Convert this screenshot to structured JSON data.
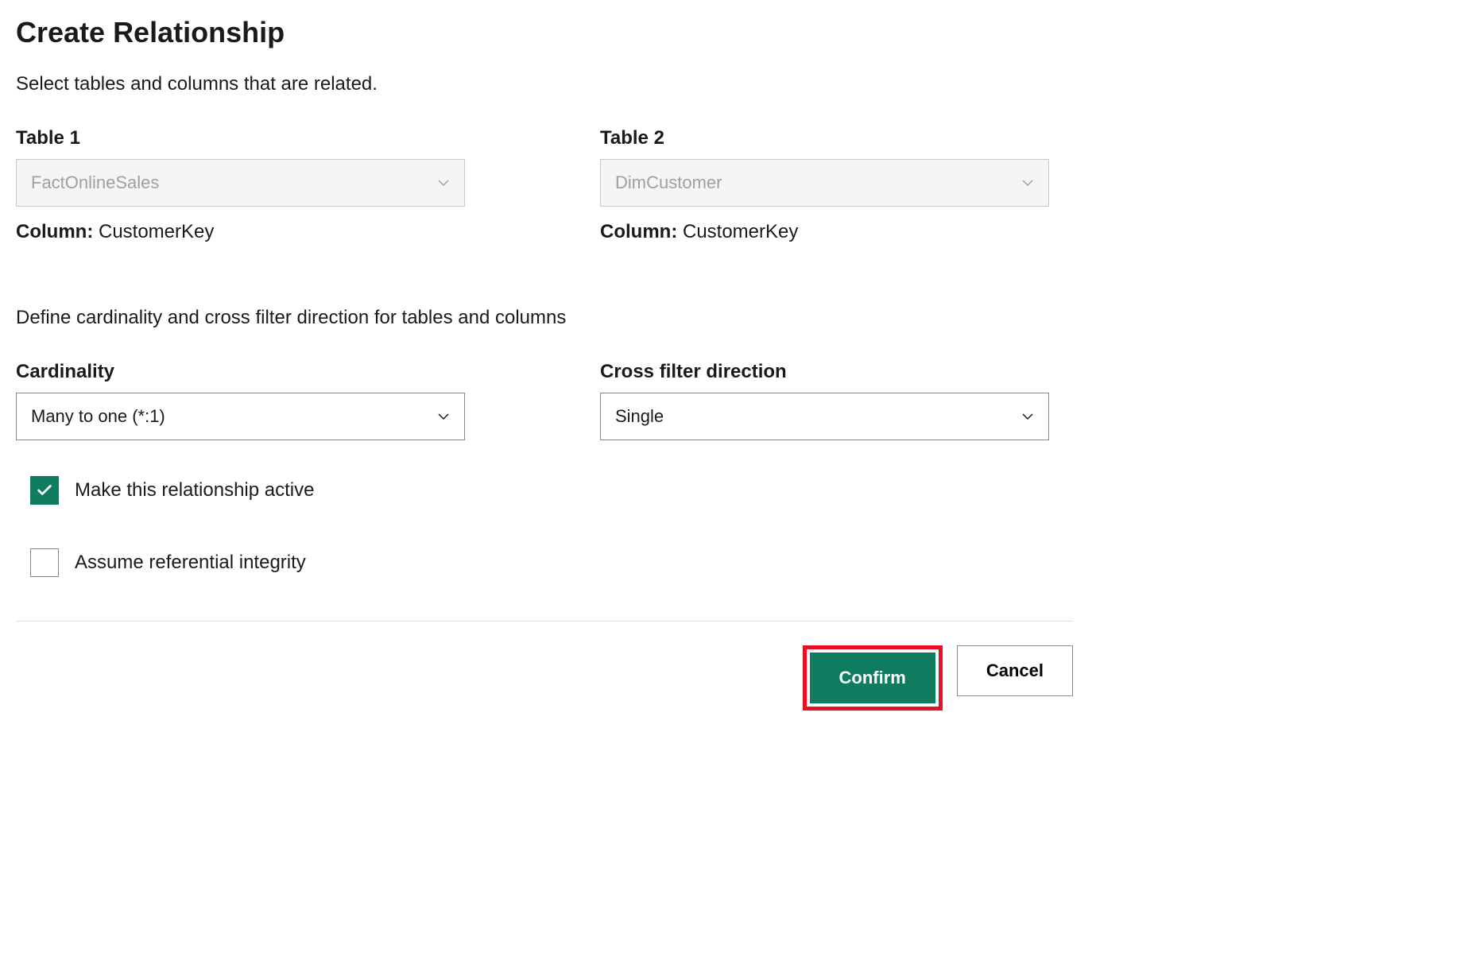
{
  "dialog": {
    "title": "Create Relationship",
    "subtitle": "Select tables and columns that are related.",
    "table1": {
      "label": "Table 1",
      "value": "FactOnlineSales",
      "columnLabel": "Column:",
      "columnValue": "CustomerKey"
    },
    "table2": {
      "label": "Table 2",
      "value": "DimCustomer",
      "columnLabel": "Column:",
      "columnValue": "CustomerKey"
    },
    "sectionText": "Define cardinality and cross filter direction for tables and columns",
    "cardinality": {
      "label": "Cardinality",
      "value": "Many to one (*:1)"
    },
    "crossFilter": {
      "label": "Cross filter direction",
      "value": "Single"
    },
    "activeCheckbox": {
      "label": "Make this relationship active",
      "checked": true
    },
    "integrityCheckbox": {
      "label": "Assume referential integrity",
      "checked": false
    },
    "buttons": {
      "confirm": "Confirm",
      "cancel": "Cancel"
    }
  }
}
